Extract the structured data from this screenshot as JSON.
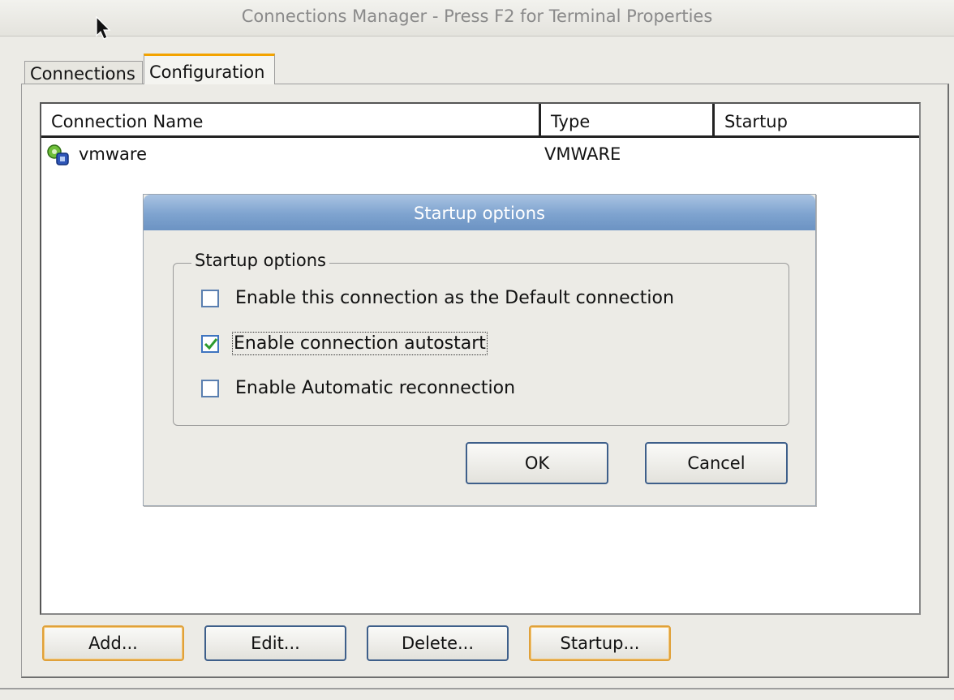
{
  "window": {
    "title": "Connections Manager - Press F2 for Terminal Properties"
  },
  "tabs": [
    {
      "label": "Connections",
      "active": false
    },
    {
      "label": "Configuration",
      "active": true
    }
  ],
  "list": {
    "columns": [
      "Connection Name",
      "Type",
      "Startup"
    ],
    "rows": [
      {
        "name": "vmware",
        "type": "VMWARE",
        "startup": ""
      }
    ]
  },
  "dialog": {
    "title": "Startup options",
    "group_label": "Startup options",
    "options": [
      {
        "label": "Enable this connection as the Default connection",
        "checked": false
      },
      {
        "label": "Enable connection autostart",
        "checked": true
      },
      {
        "label": "Enable Automatic reconnection",
        "checked": false
      }
    ],
    "ok_label": "OK",
    "cancel_label": "Cancel"
  },
  "buttons": {
    "add": "Add...",
    "edit": "Edit...",
    "delete": "Delete...",
    "startup": "Startup..."
  },
  "colors": {
    "accent_tab": "#f3a300",
    "dialog_title": "#7ea3cf",
    "check": "#2e9b2e"
  }
}
